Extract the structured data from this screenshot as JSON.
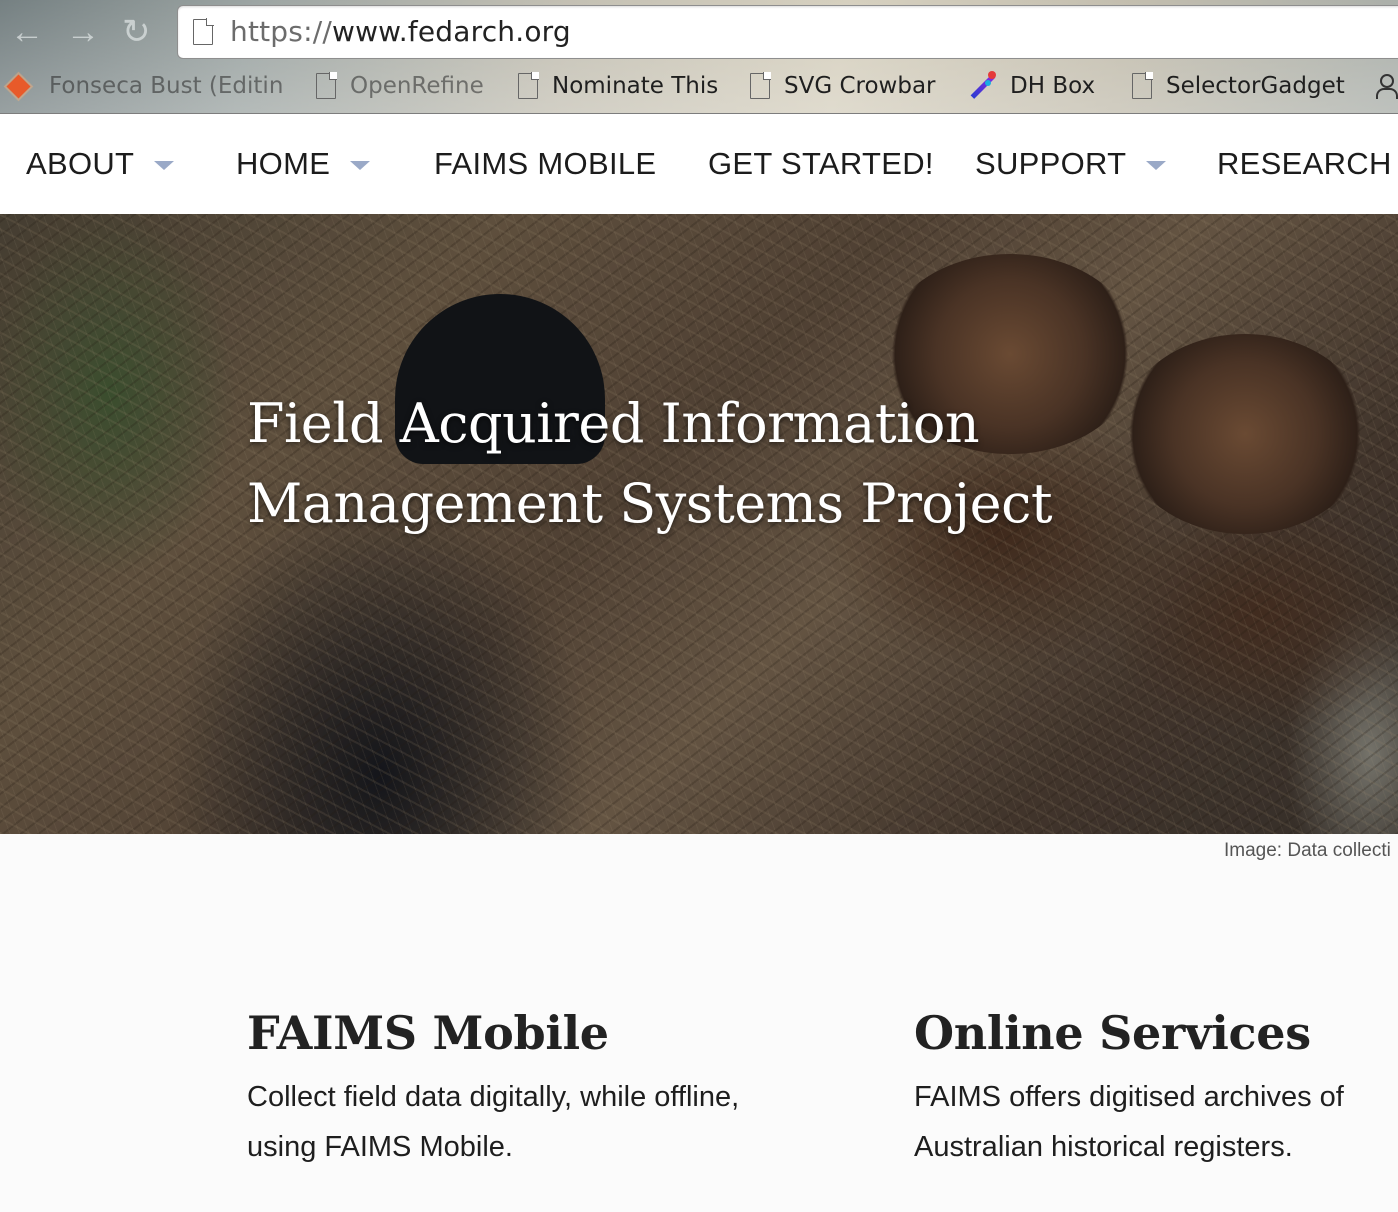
{
  "browser": {
    "url_scheme": "https://",
    "url_host": "www.fedarch.org",
    "icons": {
      "back": "back-arrow-icon",
      "forward": "forward-arrow-icon",
      "reload": "reload-icon",
      "page": "page-icon"
    },
    "bookmarks": [
      {
        "label": "Fonseca Bust (Editin",
        "icon": "diamond-icon"
      },
      {
        "label": "OpenRefine",
        "icon": "page-icon"
      },
      {
        "label": "Nominate This",
        "icon": "page-icon"
      },
      {
        "label": "SVG Crowbar",
        "icon": "page-icon"
      },
      {
        "label": "DH Box",
        "icon": "wand-icon"
      },
      {
        "label": "SelectorGadget",
        "icon": "page-icon"
      }
    ]
  },
  "site_nav": {
    "items": [
      {
        "label": "ABOUT",
        "has_dropdown": true
      },
      {
        "label": "HOME",
        "has_dropdown": true
      },
      {
        "label": "FAIMS MOBILE",
        "has_dropdown": false
      },
      {
        "label": "GET STARTED!",
        "has_dropdown": false
      },
      {
        "label": "SUPPORT",
        "has_dropdown": true
      },
      {
        "label": "RESEARCH",
        "has_dropdown": true
      }
    ],
    "caret_color": "#9aa9c7"
  },
  "hero": {
    "title_line1": "Field Acquired Information",
    "title_line2": "Management Systems Project",
    "caption": "Image: Data collecti"
  },
  "sections": [
    {
      "heading": "FAIMS Mobile",
      "text_line1": "Collect field data digitally, while offline,",
      "text_line2": "using FAIMS Mobile."
    },
    {
      "heading": "Online Services",
      "text_line1": "FAIMS offers digitised archives of",
      "text_line2": "Australian historical registers."
    }
  ]
}
